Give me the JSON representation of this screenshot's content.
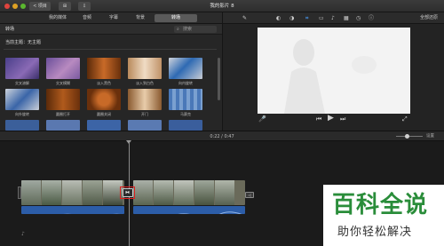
{
  "window": {
    "title": "我的影片 8",
    "back_label": "< 项目",
    "media_btn": "⊞",
    "import_btn": "⇩"
  },
  "media_tabs": [
    {
      "label": "我的媒体",
      "active": false
    },
    {
      "label": "音频",
      "active": false
    },
    {
      "label": "字幕",
      "active": false
    },
    {
      "label": "背景",
      "active": false
    },
    {
      "label": "转场",
      "active": true
    }
  ],
  "browser": {
    "header": "转场",
    "search_placeholder": "搜索",
    "theme_label": "当前主题：无主题",
    "row1": [
      {
        "label": "交叉溶解",
        "color": "#6b5a9e"
      },
      {
        "label": "交叉模糊",
        "color": "#8f6aa2"
      },
      {
        "label": "淡入黑色",
        "color": "#a2531c"
      },
      {
        "label": "淡入到白色",
        "color": "#c69a6e"
      },
      {
        "label": "向内旋转",
        "color": "#2e6ab3"
      }
    ],
    "row2": [
      {
        "label": "向外旋转",
        "color": "#3a65a8"
      },
      {
        "label": "圆圈打开",
        "color": "#9a4a14"
      },
      {
        "label": "圆圈关闭",
        "color": "#a55418"
      },
      {
        "label": "开门",
        "color": "#c9a27a"
      },
      {
        "label": "马赛克",
        "color": "#4a78b8"
      }
    ]
  },
  "viewer": {
    "reset_label": "全部还原",
    "tools": [
      "✎",
      "◐",
      "◑",
      "⌗",
      "▭",
      "♪",
      "▦",
      "◷",
      "ⓘ"
    ]
  },
  "playback": {
    "mic": "🎤",
    "prev": "⏮",
    "play": "▶",
    "next": "⏭",
    "fullscreen": "⤢"
  },
  "timeline": {
    "current": "0:22",
    "separator": " / ",
    "total": "0:47",
    "zoom_label": "设置",
    "end_label": "◁"
  },
  "watermark": {
    "main": "百科全说",
    "sub": "助你轻松解决"
  },
  "colors": {
    "accent_red": "#e02020",
    "audio_blue": "#2c5da8",
    "watermark_green": "#2a8d3a"
  }
}
